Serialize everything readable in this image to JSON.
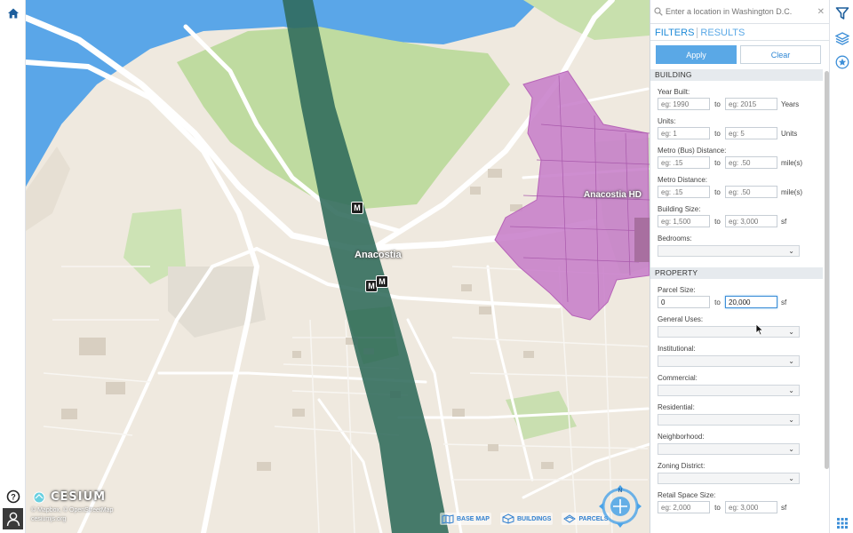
{
  "left_rail": {
    "home_icon": "home-icon",
    "help_icon": "help-icon",
    "user_icon": "user-icon"
  },
  "map": {
    "labels": {
      "anacostia": "Anacostia",
      "anacostia_hd": "Anacostia HD"
    },
    "metro_marker_label": "M",
    "cesium_word": "CESIUM",
    "credit_line1": "© Mapbox, © OpenStreetMap",
    "credit_line2": "cesiumjs.org",
    "layer_toggles": {
      "base_map": "BASE MAP",
      "buildings": "BUILDINGS",
      "parcels": "PARCELS"
    },
    "nav_label": "N",
    "colors": {
      "river": "#5aa6e8",
      "park": "#bfdba0",
      "land": "#efe9df",
      "metro_corridor": "#2f6a5a",
      "historic_district": "#c77ec9"
    }
  },
  "panel": {
    "search_placeholder": "Enter a location in Washington D.C.",
    "tabs": {
      "filters": "FILTERS",
      "results": "RESULTS"
    },
    "apply_label": "Apply",
    "clear_label": "Clear",
    "to_label": "to",
    "building": {
      "title": "BUILDING",
      "year_built": {
        "label": "Year Built:",
        "min_placeholder": "eg: 1990",
        "max_placeholder": "eg: 2015",
        "unit": "Years"
      },
      "units": {
        "label": "Units:",
        "min_placeholder": "eg: 1",
        "max_placeholder": "eg: 5",
        "unit": "Units"
      },
      "metro_bus": {
        "label": "Metro (Bus) Distance:",
        "min_placeholder": "eg: .15",
        "max_placeholder": "eg: .50",
        "unit": "mile(s)"
      },
      "metro": {
        "label": "Metro Distance:",
        "min_placeholder": "eg: .15",
        "max_placeholder": "eg: .50",
        "unit": "mile(s)"
      },
      "building_size": {
        "label": "Building Size:",
        "min_placeholder": "eg: 1,500",
        "max_placeholder": "eg: 3,000",
        "unit": "sf"
      },
      "bedrooms": {
        "label": "Bedrooms:"
      }
    },
    "property": {
      "title": "PROPERTY",
      "parcel_size": {
        "label": "Parcel Size:",
        "min_value": "0",
        "max_value": "20,000",
        "unit": "sf"
      },
      "general_uses": {
        "label": "General Uses:"
      },
      "institutional": {
        "label": "Institutional:"
      },
      "commercial": {
        "label": "Commercial:"
      },
      "residential": {
        "label": "Residential:"
      },
      "neighborhood": {
        "label": "Neighborhood:"
      },
      "zoning_district": {
        "label": "Zoning District:"
      },
      "retail_space_size": {
        "label": "Retail Space Size:",
        "min_placeholder": "eg: 2,000",
        "max_placeholder": "eg: 3,000",
        "unit": "sf"
      }
    }
  },
  "right_rail": {
    "filter_icon": "filter-icon",
    "layers_icon": "layers-icon",
    "favorites_icon": "star-icon",
    "apps_icon": "grid-icon",
    "accent": "#2f87d4"
  }
}
